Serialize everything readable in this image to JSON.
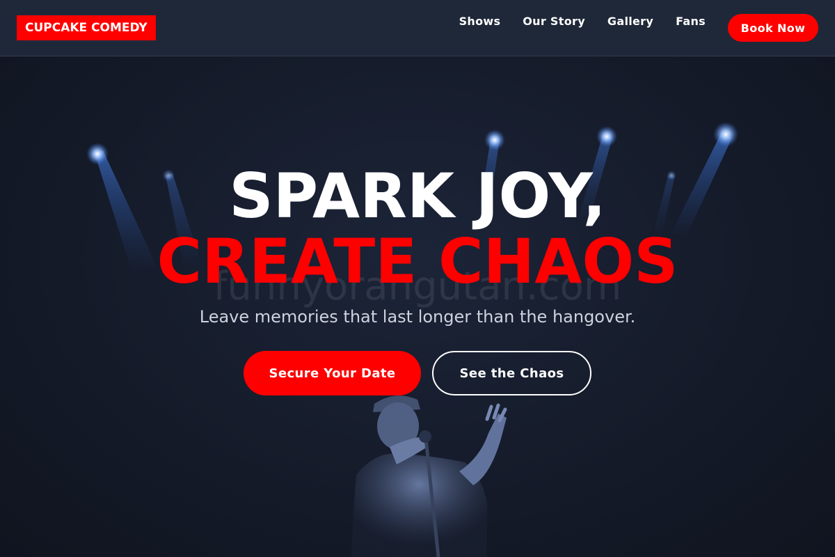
{
  "brand": {
    "name": "CUPCAKE COMEDY"
  },
  "nav": {
    "links": [
      "Shows",
      "Our Story",
      "Gallery",
      "Fans"
    ],
    "cta_label": "Book Now"
  },
  "hero": {
    "headline_line1": "SPARK JOY,",
    "headline_line2": "CREATE CHAOS",
    "watermark": "funnyorangutan.com",
    "subtitle": "Leave memories that last longer than the hangover.",
    "primary_cta": "Secure Your Date",
    "secondary_cta": "See the Chaos",
    "background_image": "comedian-on-stage-with-microphone-under-blue-spotlights"
  },
  "colors": {
    "accent": "#ff0000",
    "nav_background": "#1f2839",
    "hero_background": "#141a28",
    "spotlight": "#4a8cff"
  }
}
